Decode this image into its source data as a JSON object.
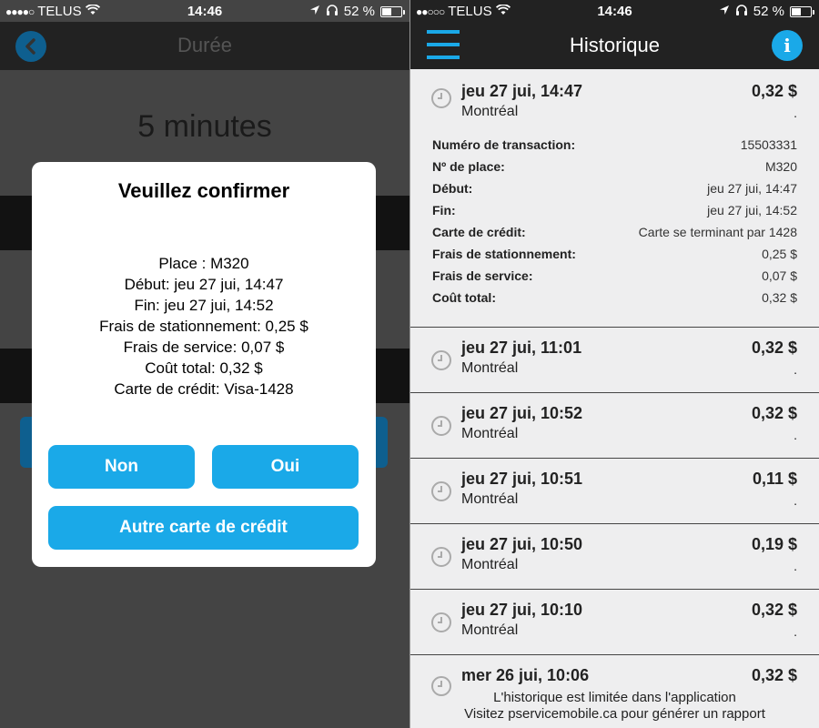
{
  "status_bar": {
    "carrier": "TELUS",
    "time": "14:46",
    "battery": "52 %",
    "battery_level": 0.52
  },
  "confirm_screen": {
    "title": "Durée",
    "duration": "5 minutes",
    "dialog": {
      "title": "Veuillez confirmer",
      "lines": [
        "Place : M320",
        "Début: jeu 27 jui, 14:47",
        "Fin: jeu 27 jui, 14:52",
        "Frais de stationnement: 0,25 $",
        "Frais de service: 0,07 $",
        "Coût total: 0,32 $",
        "Carte de crédit: Visa-1428"
      ],
      "no_label": "Non",
      "yes_label": "Oui",
      "other_card_label": "Autre carte de crédit"
    }
  },
  "history_screen": {
    "title": "Historique",
    "info_icon": "i",
    "expanded": {
      "date": "jeu 27 jui, 14:47",
      "city": "Montréal",
      "amount": "0,32 $",
      "dot": ".",
      "details": [
        {
          "label": "Numéro de transaction:",
          "value": "15503331"
        },
        {
          "label": "Nº de place:",
          "value": "M320"
        },
        {
          "label": "Début:",
          "value": "jeu 27 jui, 14:47"
        },
        {
          "label": "Fin:",
          "value": "jeu 27 jui, 14:52"
        },
        {
          "label": "Carte de crédit:",
          "value": "Carte se terminant par 1428"
        },
        {
          "label": "Frais de stationnement:",
          "value": "0,25 $"
        },
        {
          "label": "Frais de service:",
          "value": "0,07 $"
        },
        {
          "label": "Coût total:",
          "value": "0,32 $"
        }
      ]
    },
    "items": [
      {
        "date": "jeu 27 jui, 11:01",
        "city": "Montréal",
        "amount": "0,32 $",
        "dot": "."
      },
      {
        "date": "jeu 27 jui, 10:52",
        "city": "Montréal",
        "amount": "0,32 $",
        "dot": "."
      },
      {
        "date": "jeu 27 jui, 10:51",
        "city": "Montréal",
        "amount": "0,11 $",
        "dot": "."
      },
      {
        "date": "jeu 27 jui, 10:50",
        "city": "Montréal",
        "amount": "0,19 $",
        "dot": "."
      },
      {
        "date": "jeu 27 jui, 10:10",
        "city": "Montréal",
        "amount": "0,32 $",
        "dot": "."
      },
      {
        "date": "mer 26 jui, 10:06",
        "amount": "0,32 $"
      }
    ],
    "footer_line1": "L'historique est limitée dans l'application",
    "footer_line2": "Visitez pservicemobile.ca pour générer un rapport"
  },
  "colors": {
    "accent": "#1aa9e8",
    "navbar": "#222222",
    "list_bg": "#eeeeef"
  }
}
